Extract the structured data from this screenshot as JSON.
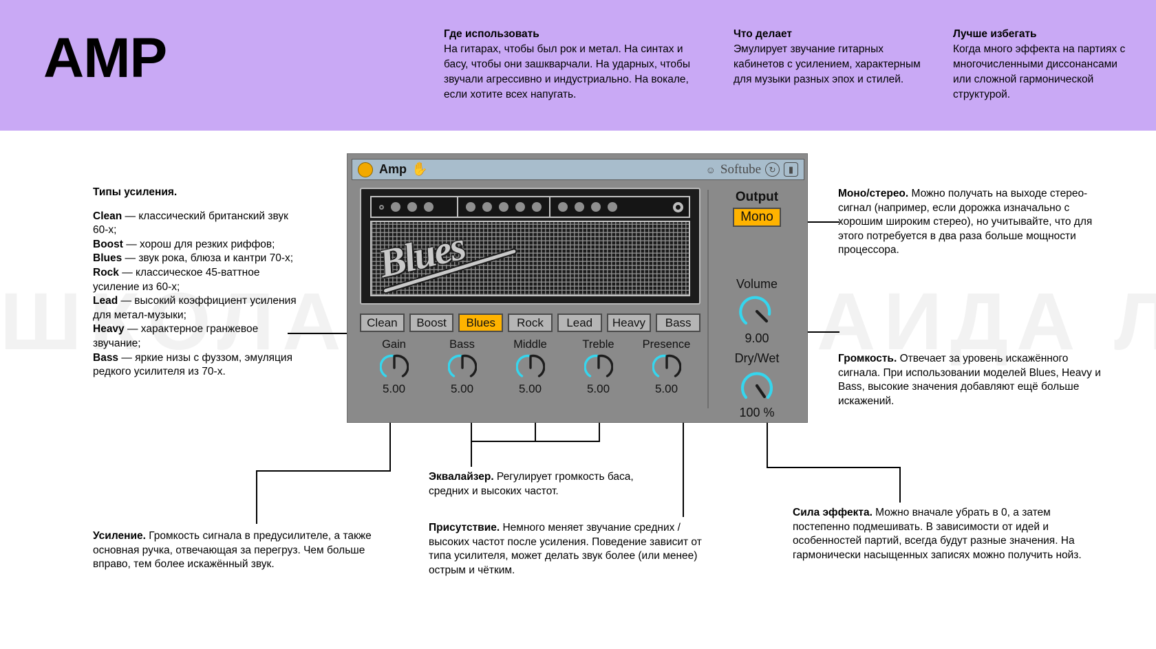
{
  "header": {
    "title": "AMP",
    "columns": [
      {
        "title": "Где использовать",
        "body": "На гитарах, чтобы был рок и метал. На синтах и басу, чтобы они зашкварчали. На ударных, чтобы звучали агрессивно и индустриально. На вокале, если хотите всех напугать."
      },
      {
        "title": "Что делает",
        "body": "Эмулирует звучание гитарных кабинетов с усилением, характерным для музыки разных эпох и стилей."
      },
      {
        "title": "Лучше избегать",
        "body": "Когда много эффекта на партиях с многочисленными диссонансами или сложной гармонической структурой."
      }
    ]
  },
  "watermark": "ШКОЛА МУЗЫКИ АИДА ЛЕ",
  "plugin": {
    "titlebar": {
      "power_icon": "power-dot-icon",
      "name": "Amp",
      "hand_icon": "hand-icon",
      "smile_icon": "smile-icon",
      "brand": "Softube",
      "refresh_icon": "refresh-icon",
      "save_icon": "save-icon"
    },
    "cabinet": {
      "logo": "Blues",
      "panel_knob_groups": [
        4,
        5,
        4
      ]
    },
    "presets": [
      {
        "label": "Clean",
        "active": false
      },
      {
        "label": "Boost",
        "active": false
      },
      {
        "label": "Blues",
        "active": true
      },
      {
        "label": "Rock",
        "active": false
      },
      {
        "label": "Lead",
        "active": false
      },
      {
        "label": "Heavy",
        "active": false
      },
      {
        "label": "Bass",
        "active": false
      }
    ],
    "knobs": [
      {
        "label": "Gain",
        "value": "5.00"
      },
      {
        "label": "Bass",
        "value": "5.00"
      },
      {
        "label": "Middle",
        "value": "5.00"
      },
      {
        "label": "Treble",
        "value": "5.00"
      },
      {
        "label": "Presence",
        "value": "5.00"
      }
    ],
    "output": {
      "title": "Output",
      "mono_label": "Mono",
      "volume_label": "Volume",
      "volume_value": "9.00",
      "drywet_label": "Dry/Wet",
      "drywet_value": "100 %"
    },
    "colors": {
      "accent_orange": "#ffb300",
      "knob_cyan": "#35d6ee",
      "titlebar_blue": "#a8bdcc",
      "body_grey": "#8a8a8a"
    }
  },
  "callouts": {
    "types": {
      "title": "Типы усиления.",
      "items": [
        {
          "name": "Clean",
          "text": " — классический британский звук 60-х;"
        },
        {
          "name": "Boost",
          "text": " — хорош для резких риффов;"
        },
        {
          "name": "Blues",
          "text": " — звук рока, блюза и кантри 70-х;"
        },
        {
          "name": "Rock",
          "text": " — классическое 45-ваттное усиление из 60-х;"
        },
        {
          "name": "Lead",
          "text": " — высокий коэффициент усиления для метал-музыки;"
        },
        {
          "name": "Heavy",
          "text": " — характерное гранжевое звучание;"
        },
        {
          "name": "Bass",
          "text": " — яркие низы с фуззом, эмуляция редкого усилителя из 70-х."
        }
      ]
    },
    "mono": {
      "title": "Моно/стерео.",
      "body": " Можно получать на выходе стерео-сигнал (например, если дорожка изначально с хорошим широким стерео), но учитывайте, что для этого потребуется в два раза больше мощности процессора."
    },
    "volume": {
      "title": "Громкость.",
      "body": " Отвечает за уровень искажённого сигнала. При использовании моделей Blues, Heavy и Bass, высокие значения добавляют ещё больше искажений."
    },
    "gain": {
      "title": "Усиление.",
      "body": " Громкость сигнала в предусилителе, а также основная ручка, отвечающая за перегруз. Чем больше вправо, тем более искажённый звук."
    },
    "eq": {
      "title": "Эквалайзер.",
      "body": " Регулирует громкость баса, средних и высоких частот."
    },
    "presence": {
      "title": "Присутствие.",
      "body": " Немного меняет звучание средних / высоких частот после усиления. Поведение зависит от типа усилителя, может делать звук более (или менее) острым и чётким."
    },
    "force": {
      "title": "Сила эффекта.",
      "body": " Можно вначале убрать в 0, а затем постепенно подмешивать. В зависимости от идей и особенностей партий, всегда будут разные значения. На гармонически насыщенных записях можно получить нойз."
    }
  }
}
